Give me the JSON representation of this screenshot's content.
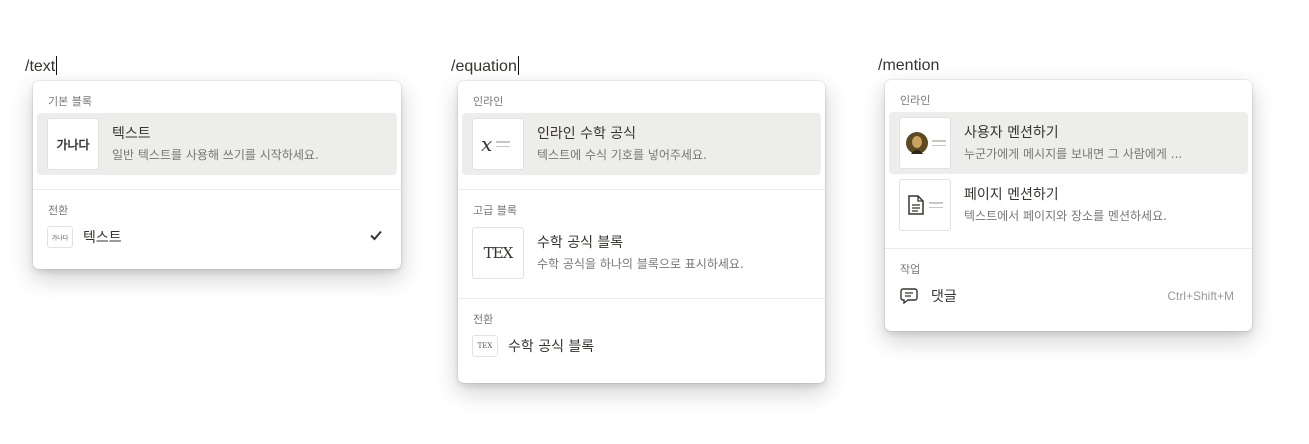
{
  "panels": [
    {
      "command": "/text",
      "sections": [
        {
          "label": "기본 블록",
          "items": [
            {
              "thumb_text": "가나다",
              "title": "텍스트",
              "description": "일반 텍스트를 사용해 쓰기를 시작하세요."
            }
          ]
        },
        {
          "label": "전환",
          "rows": [
            {
              "mini_text": "가나다",
              "label": "텍스트",
              "icon": "checkmark-icon"
            }
          ]
        }
      ]
    },
    {
      "command": "/equation",
      "sections": [
        {
          "label": "인라인",
          "items": [
            {
              "thumb_text": "x",
              "title": "인라인 수학 공식",
              "description": "텍스트에 수식 기호를 넣어주세요."
            }
          ]
        },
        {
          "label": "고급 블록",
          "items": [
            {
              "thumb_text": "TEX",
              "title": "수학 공식 블록",
              "description": "수학 공식을 하나의 블록으로 표시하세요."
            }
          ]
        },
        {
          "label": "전환",
          "rows": [
            {
              "mini_text": "TEX",
              "label": "수학 공식 블록"
            }
          ]
        }
      ]
    },
    {
      "command": "/mention",
      "sections": [
        {
          "label": "인라인",
          "items": [
            {
              "icon": "mona-lisa-avatar-icon",
              "title": "사용자 멘션하기",
              "description": "누군가에게 메시지를 보내면 그 사람에게 ..."
            },
            {
              "icon": "page-icon",
              "title": "페이지 멘션하기",
              "description": "텍스트에서 페이지와 장소를 멘션하세요."
            }
          ]
        },
        {
          "label": "작업",
          "rows": [
            {
              "icon": "comment-icon",
              "label": "댓글",
              "shortcut": "Ctrl+Shift+M"
            }
          ]
        }
      ]
    }
  ]
}
